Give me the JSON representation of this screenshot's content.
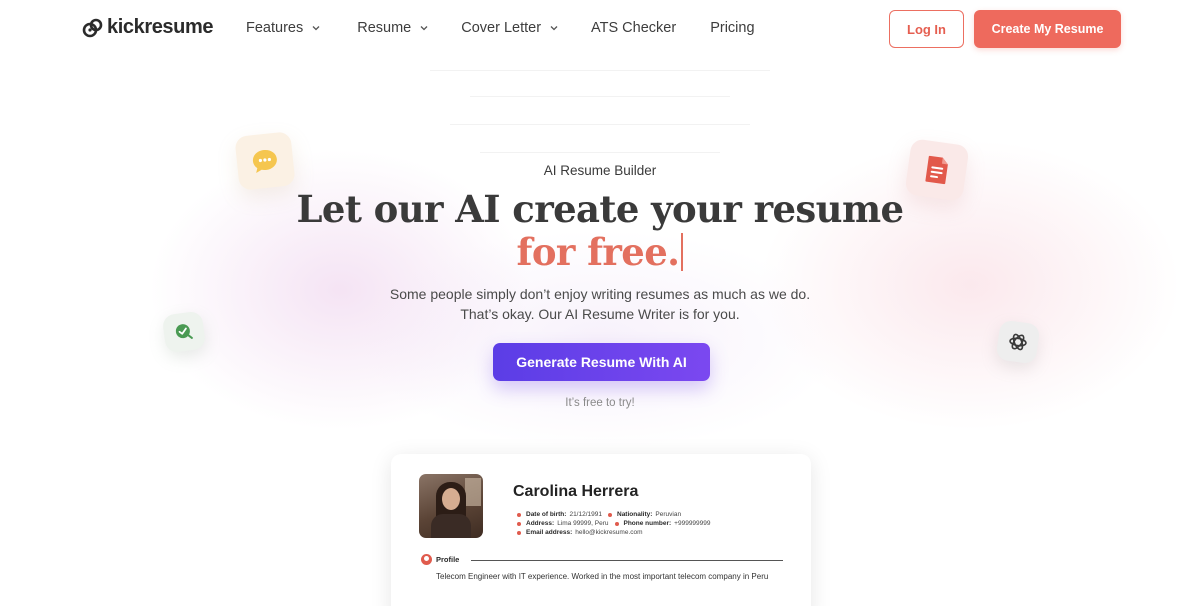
{
  "brand": {
    "name": "kickresume",
    "accent": "#ee6a5d",
    "purple": "#5b3de6"
  },
  "nav": {
    "items": [
      {
        "label": "Features",
        "dropdown": true
      },
      {
        "label": "Resume",
        "dropdown": true
      },
      {
        "label": "Cover Letter",
        "dropdown": true
      },
      {
        "label": "ATS Checker",
        "dropdown": false
      },
      {
        "label": "Pricing",
        "dropdown": false
      }
    ]
  },
  "auth": {
    "login_label": "Log In",
    "create_label": "Create My Resume"
  },
  "hero": {
    "eyebrow": "AI Resume Builder",
    "headline_line1": "Let our AI create your resume",
    "headline_accent": "for free.",
    "subtitle_line1": "Some people simply don’t enjoy writing resumes as much as we do.",
    "subtitle_line2": "That’s okay. Our AI Resume Writer is for you.",
    "cta_label": "Generate Resume With AI",
    "cta_note": "It’s free to try!"
  },
  "floating_icons": [
    "chat-bubble-icon",
    "document-icon",
    "check-icon",
    "openai-icon"
  ],
  "resume_preview": {
    "name": "Carolina Herrera",
    "fields": {
      "dob_label": "Date of birth:",
      "dob": "21/12/1991",
      "nationality_label": "Nationality:",
      "nationality": "Peruvian",
      "address_label": "Address:",
      "address": "Lima 99999, Peru",
      "phone_label": "Phone number:",
      "phone": "+999999999",
      "email_label": "Email address:",
      "email": "hello@kickresume.com"
    },
    "section_title": "Profile",
    "profile_text": "Telecom Engineer with IT experience. Worked in the most important telecom company in Peru"
  }
}
